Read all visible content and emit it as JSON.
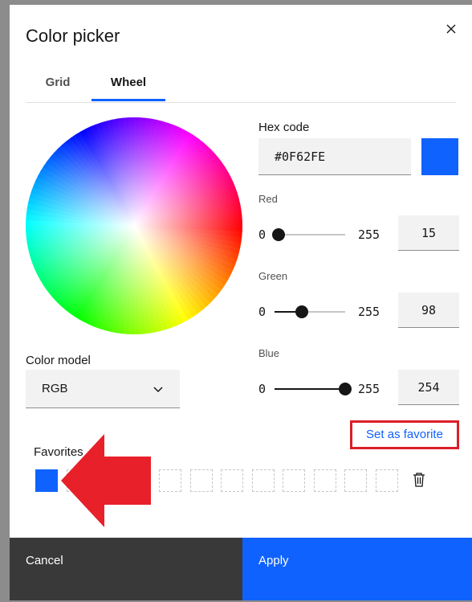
{
  "dialog": {
    "title": "Color picker",
    "tabs": [
      {
        "label": "Grid"
      },
      {
        "label": "Wheel"
      }
    ],
    "active_tab": "Wheel"
  },
  "hex": {
    "label": "Hex code",
    "value": "#0F62FE"
  },
  "sliders": [
    {
      "label": "Red",
      "min": "0",
      "max": "255",
      "value": "15"
    },
    {
      "label": "Green",
      "min": "0",
      "max": "255",
      "value": "98"
    },
    {
      "label": "Blue",
      "min": "0",
      "max": "255",
      "value": "254"
    }
  ],
  "color_model": {
    "label": "Color model",
    "value": "RGB"
  },
  "favorites": {
    "label": "Favorites",
    "set_label": "Set as favorite",
    "slots_filled": 1,
    "slots_total": 12
  },
  "footer": {
    "cancel": "Cancel",
    "apply": "Apply"
  },
  "colors": {
    "accent": "#0f62fe",
    "selected": "#0F62FE",
    "highlight": "#da1e28",
    "arrow": "#e8202a"
  },
  "icons": {
    "close": "close-icon",
    "chevron": "chevron-down-icon",
    "trash": "trash-icon"
  }
}
